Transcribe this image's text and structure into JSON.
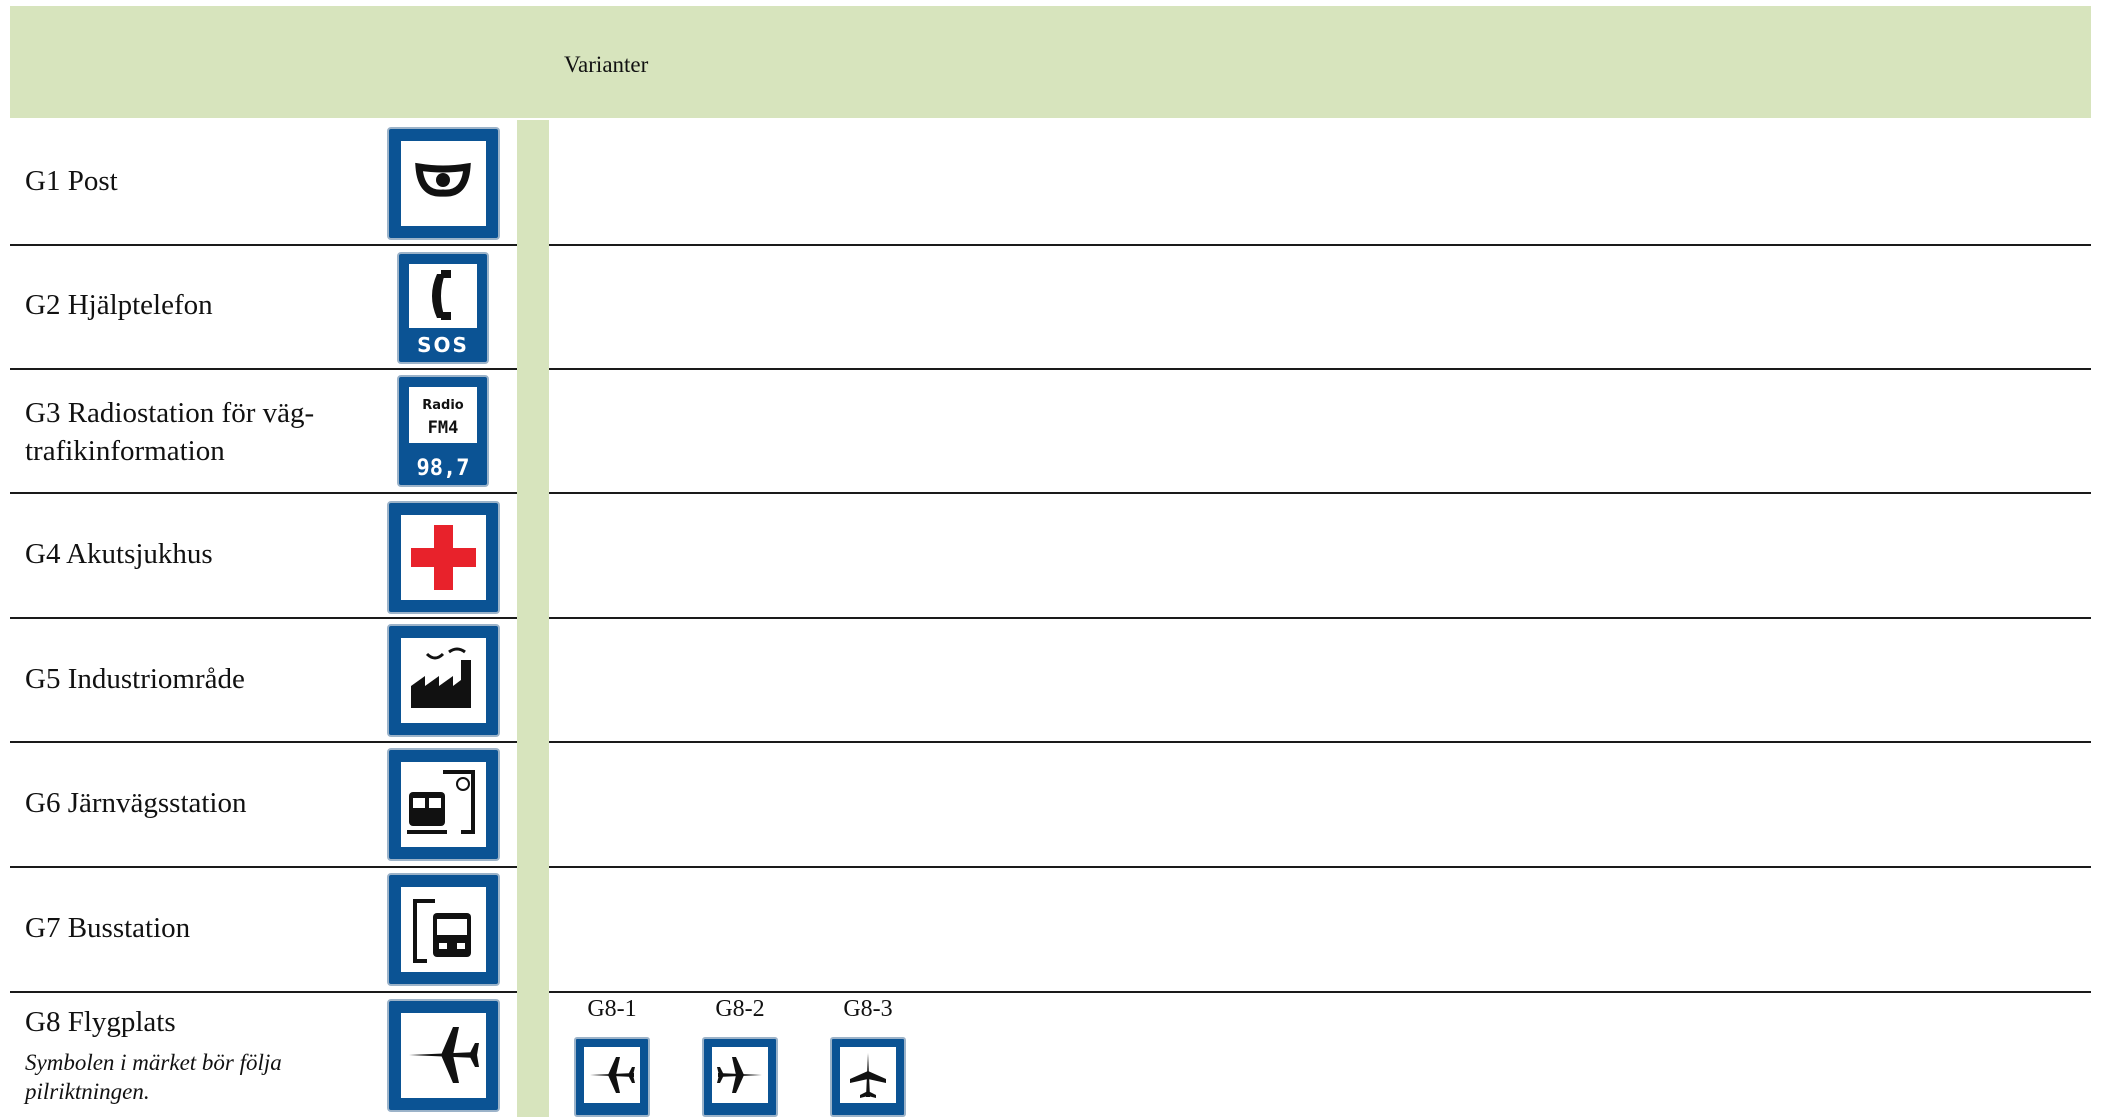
{
  "header": {
    "title": "Varianter"
  },
  "rows": [
    {
      "code": "G1 Post",
      "icon": "post-horn-icon"
    },
    {
      "code": "G2 Hjälptelefon",
      "icon": "sos-phone-icon",
      "sign_text": "SOS"
    },
    {
      "code": "G3 Radiostation för väg-trafikinformation",
      "line1": "G3 Radiostation för väg-",
      "line2": "trafikinformation",
      "icon": "radio-icon",
      "sign_text_1": "Radio",
      "sign_text_2": "FM4",
      "sign_text_3": "98,7"
    },
    {
      "code": "G4 Akutsjukhus",
      "icon": "red-cross-icon"
    },
    {
      "code": "G5 Industriområde",
      "icon": "factory-icon"
    },
    {
      "code": "G6 Järnvägsstation",
      "icon": "train-station-icon"
    },
    {
      "code": "G7 Busstation",
      "icon": "bus-station-icon"
    },
    {
      "code": "G8 Flygplats",
      "icon": "airplane-icon",
      "note": "Symbolen i märket bör följa pilriktningen."
    }
  ],
  "variants": [
    {
      "label": "G8-1",
      "icon": "airplane-left-icon"
    },
    {
      "label": "G8-2",
      "icon": "airplane-right-icon"
    },
    {
      "label": "G8-3",
      "icon": "airplane-up-icon"
    }
  ],
  "colors": {
    "header_bg": "#d7e4bd",
    "sign_blue": "#0b5394",
    "cross_red": "#e8222b"
  }
}
